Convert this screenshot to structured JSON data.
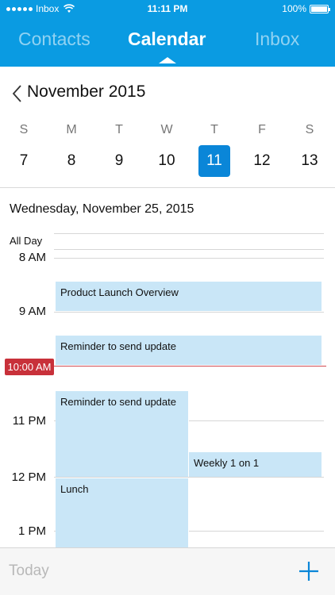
{
  "status_bar": {
    "carrier": "Inbox",
    "time": "11:11 PM",
    "battery": "100%"
  },
  "tabs": [
    {
      "label": "Contacts",
      "active": false
    },
    {
      "label": "Calendar",
      "active": true
    },
    {
      "label": "Inbox",
      "active": false
    }
  ],
  "month_title": "November 2015",
  "weekdays": [
    "S",
    "M",
    "T",
    "W",
    "T",
    "F",
    "S"
  ],
  "dates": [
    "7",
    "8",
    "9",
    "10",
    "11",
    "12",
    "13"
  ],
  "selected_date_index": 4,
  "day_title": "Wednesday, November 25, 2015",
  "all_day_label": "All Day",
  "hour_labels": [
    "8 AM",
    "9 AM",
    "11 PM",
    "12 PM",
    "1 PM"
  ],
  "current_time": "10:00 AM",
  "events": [
    {
      "title": "Product Launch Overview"
    },
    {
      "title": "Reminder to send update"
    },
    {
      "title": "Reminder to send update"
    },
    {
      "title": "Weekly 1 on 1"
    },
    {
      "title": "Lunch"
    }
  ],
  "bottom_bar": {
    "today_label": "Today",
    "add_icon": "plus-icon"
  },
  "colors": {
    "header_blue": "#0a9be2",
    "selected_blue": "#0a86d8",
    "event_fill": "#c9e6f7",
    "now_red": "#c8313a"
  }
}
